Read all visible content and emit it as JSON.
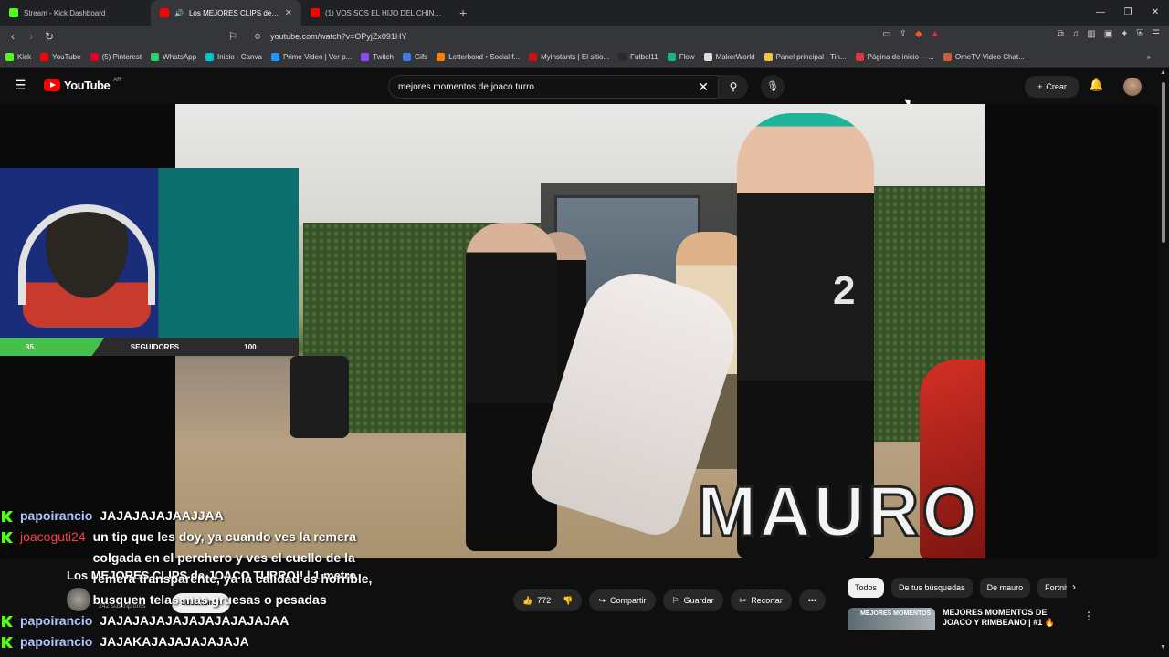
{
  "browser": {
    "tabs": [
      {
        "label": "Stream - Kick Dashboard",
        "favicon_color": "#53fc18"
      },
      {
        "label": "Los MEJORES CLIPS de JOACO",
        "favicon_color": "#ff0000"
      },
      {
        "label": "(1) VOS SOS EL HIJO DEL CHINO MA",
        "favicon_color": "#ff0000"
      }
    ],
    "new_tab_label": "+",
    "address": "youtube.com/watch?v=OPyjZx091HY",
    "bookmarks": [
      {
        "label": "Kick",
        "color": "#53fc18"
      },
      {
        "label": "YouTube",
        "color": "#ff0000"
      },
      {
        "label": "(5) Pinterest",
        "color": "#e60023"
      },
      {
        "label": "WhatsApp",
        "color": "#25d366"
      },
      {
        "label": "Inicio - Canva",
        "color": "#00c4cc"
      },
      {
        "label": "Prime Video | Ver p...",
        "color": "#1a98ff"
      },
      {
        "label": "Twitch",
        "color": "#9146ff"
      },
      {
        "label": "Gifs",
        "color": "#3d7be8"
      },
      {
        "label": "Letterboxd • Social f...",
        "color": "#ff8000"
      },
      {
        "label": "Myinstants | El sitio...",
        "color": "#d01010"
      },
      {
        "label": "Futbol11",
        "color": "#2a2a2a"
      },
      {
        "label": "Flow",
        "color": "#14b888"
      },
      {
        "label": "MakerWorld",
        "color": "#dddddd"
      },
      {
        "label": "Panel principal - Tin...",
        "color": "#f5c242"
      },
      {
        "label": "Página de inicio —...",
        "color": "#e2323b"
      },
      {
        "label": "OmeTV Video Chat...",
        "color": "#d45c34"
      }
    ]
  },
  "youtube": {
    "logo": "YouTube",
    "country": "AR",
    "search_value": "mejores momentos de joaco turro",
    "create_label": "Crear",
    "video_overlay_name": "MAURO",
    "jersey_number": "2",
    "video_title": "Los MEJORES CLIPS de JOACO TURRO!! | 1 metro",
    "channel_name": "mauro",
    "subscribers": "242 suscriptores",
    "subscribe_label": "Suscribirse",
    "likes": "772",
    "share_label": "Compartir",
    "save_label": "Guardar",
    "clip_label": "Recortar",
    "more_label": "•••",
    "chips": [
      "Todos",
      "De tus búsquedas",
      "De mauro",
      "Fortnite"
    ],
    "recommended": {
      "thumb_text": "MEJORES MOMENTOS",
      "title": "MEJORES MOMENTOS DE JOACO Y RIMBEANO | #1 🔥"
    }
  },
  "stream_overlay": {
    "followers_current": "35",
    "followers_label": "SEGUIDORES",
    "followers_goal": "100",
    "followers_progress": 0.35
  },
  "chat": [
    {
      "user": "papoirancio",
      "message": "JAJAJAJAJAAJJAA",
      "style": "a"
    },
    {
      "user": "joacoguti24",
      "message": "un tip que les doy, ya cuando ves la remera colgada en el perchero y ves el cuello de la remera transparente, ya la calidad es horrible, busquen telas mas gruesas o pesadas",
      "style": "b"
    },
    {
      "user": "papoirancio",
      "message": "JAJAJAJAJAJAJAJAJAJAJAA",
      "style": "a"
    },
    {
      "user": "papoirancio",
      "message": "JAJAKAJAJAJAJAJAJA",
      "style": "a"
    }
  ]
}
